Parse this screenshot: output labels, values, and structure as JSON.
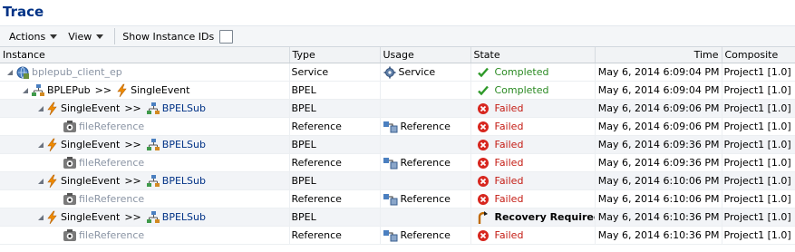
{
  "title": "Trace",
  "toolbar": {
    "actions": "Actions",
    "view": "View",
    "show_ids": "Show Instance IDs"
  },
  "columns": {
    "instance": "Instance",
    "type": "Type",
    "usage": "Usage",
    "state": "State",
    "time": "Time",
    "composite": "Composite"
  },
  "rows": [
    {
      "level": 0,
      "name": "bplepub_client_ep",
      "name_style": "gray",
      "type": "Service",
      "usage": "Service",
      "state": "Completed",
      "time": "May 6, 2014 6:09:04 PM",
      "composite": "Project1 [1.0]"
    },
    {
      "level": 1,
      "name": "BPLEPub",
      "sep": ">>",
      "target": "SingleEvent",
      "type": "BPEL",
      "usage": "",
      "state": "Completed",
      "time": "May 6, 2014 6:09:04 PM",
      "composite": "Project1 [1.0]"
    },
    {
      "level": 2,
      "name": "SingleEvent",
      "sep": ">>",
      "target": "BPELSub",
      "type": "BPEL",
      "usage": "",
      "state": "Failed",
      "time": "May 6, 2014 6:09:06 PM",
      "composite": "Project1 [1.0]"
    },
    {
      "level": 3,
      "name": "fileReference",
      "name_style": "gray",
      "type": "Reference",
      "usage": "Reference",
      "state": "Failed",
      "time": "May 6, 2014 6:09:06 PM",
      "composite": "Project1 [1.0]"
    },
    {
      "level": 2,
      "name": "SingleEvent",
      "sep": ">>",
      "target": "BPELSub",
      "type": "BPEL",
      "usage": "",
      "state": "Failed",
      "time": "May 6, 2014 6:09:36 PM",
      "composite": "Project1 [1.0]"
    },
    {
      "level": 3,
      "name": "fileReference",
      "name_style": "gray",
      "type": "Reference",
      "usage": "Reference",
      "state": "Failed",
      "time": "May 6, 2014 6:09:36 PM",
      "composite": "Project1 [1.0]"
    },
    {
      "level": 2,
      "name": "SingleEvent",
      "sep": ">>",
      "target": "BPELSub",
      "type": "BPEL",
      "usage": "",
      "state": "Failed",
      "time": "May 6, 2014 6:10:06 PM",
      "composite": "Project1 [1.0]"
    },
    {
      "level": 3,
      "name": "fileReference",
      "name_style": "gray",
      "type": "Reference",
      "usage": "Reference",
      "state": "Failed",
      "time": "May 6, 2014 6:10:06 PM",
      "composite": "Project1 [1.0]"
    },
    {
      "level": 2,
      "name": "SingleEvent",
      "sep": ">>",
      "target": "BPELSub",
      "type": "BPEL",
      "usage": "",
      "state": "Recovery Required",
      "time": "May 6, 2014 6:10:36 PM",
      "composite": "Project1 [1.0]"
    },
    {
      "level": 3,
      "name": "fileReference",
      "name_style": "gray",
      "type": "Reference",
      "usage": "Reference",
      "state": "Failed",
      "time": "May 6, 2014 6:10:36 PM",
      "composite": "Project1 [1.0]"
    }
  ]
}
